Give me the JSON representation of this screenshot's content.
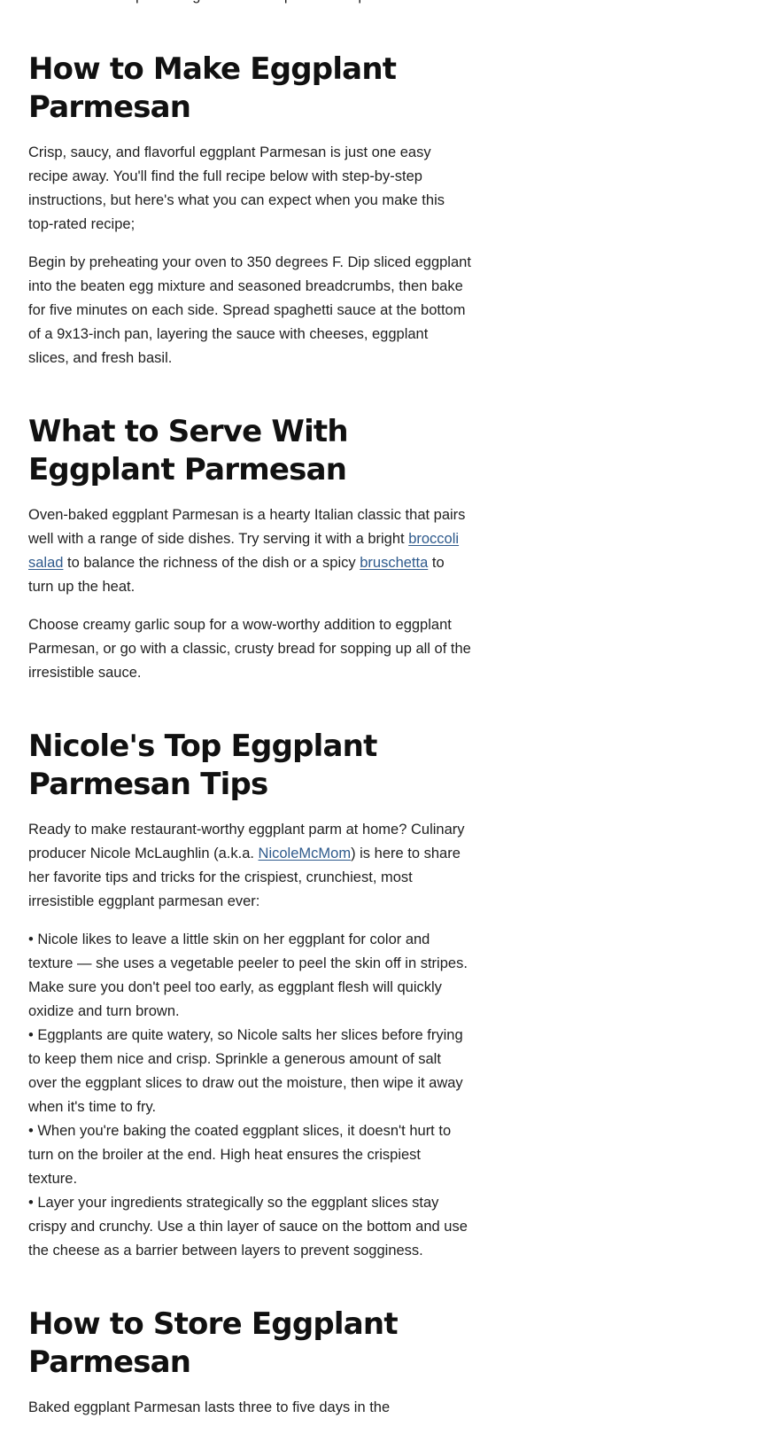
{
  "intro_tail": "create Italian-inspired magic with this top-rated recipe.",
  "sections": {
    "how_to_make": {
      "heading": "How to Make Eggplant Parmesan",
      "p1": "Crisp, saucy, and flavorful eggplant Parmesan is just one easy recipe away. You'll find the full recipe below with step-by-step instructions, but here's what you can expect when you make this top-rated recipe;",
      "p2": "Begin by preheating your oven to 350 degrees F. Dip sliced eggplant into the beaten egg mixture and seasoned breadcrumbs, then bake for five minutes on each side. Spread spaghetti sauce at the bottom of a 9x13-inch pan, layering the sauce with cheeses, eggplant slices, and fresh basil."
    },
    "what_to_serve": {
      "heading": "What to Serve With Eggplant Parmesan",
      "p1_a": "Oven-baked eggplant Parmesan is a hearty Italian classic that pairs well with a range of side dishes. Try serving it with a bright ",
      "p1_link1": "broccoli salad",
      "p1_b": " to balance the richness of the dish or a spicy ",
      "p1_link2": "bruschetta",
      "p1_c": " to turn up the heat.",
      "p2": "Choose creamy garlic soup for a wow-worthy addition to eggplant Parmesan, or go with a classic, crusty bread for sopping up all of the irresistible sauce."
    },
    "tips": {
      "heading": "Nicole's Top Eggplant Parmesan Tips",
      "p1_a": "Ready to make restaurant-worthy eggplant parm at home? Culinary producer Nicole McLaughlin (a.k.a. ",
      "p1_link": "NicoleMcMom",
      "p1_b": ") is here to share her favorite tips and tricks for the crispiest, crunchiest, most irresistible eggplant parmesan ever:",
      "bullets": [
        "• Nicole likes to leave a little skin on her eggplant for color and texture — she uses a vegetable peeler to peel the skin off in stripes. Make sure you don't peel too early, as eggplant flesh will quickly oxidize and turn brown.",
        "• Eggplants are quite watery, so Nicole salts her slices before frying to keep them nice and crisp. Sprinkle a generous amount of salt over the eggplant slices to draw out the moisture, then wipe it away when it's time to fry.",
        "• When you're baking the coated eggplant slices, it doesn't hurt to turn on the broiler at the end. High heat ensures the crispiest texture.",
        "• Layer your ingredients strategically so the eggplant slices stay crispy and crunchy. Use a thin layer of sauce on the bottom and use the cheese as a barrier between layers to prevent sogginess."
      ]
    },
    "store": {
      "heading": "How to Store Eggplant Parmesan",
      "p1": "Baked eggplant Parmesan lasts three to five days in the"
    }
  },
  "colors": {
    "link": "#2e5a8c",
    "text": "#1f1f1f",
    "heading": "#111111"
  }
}
